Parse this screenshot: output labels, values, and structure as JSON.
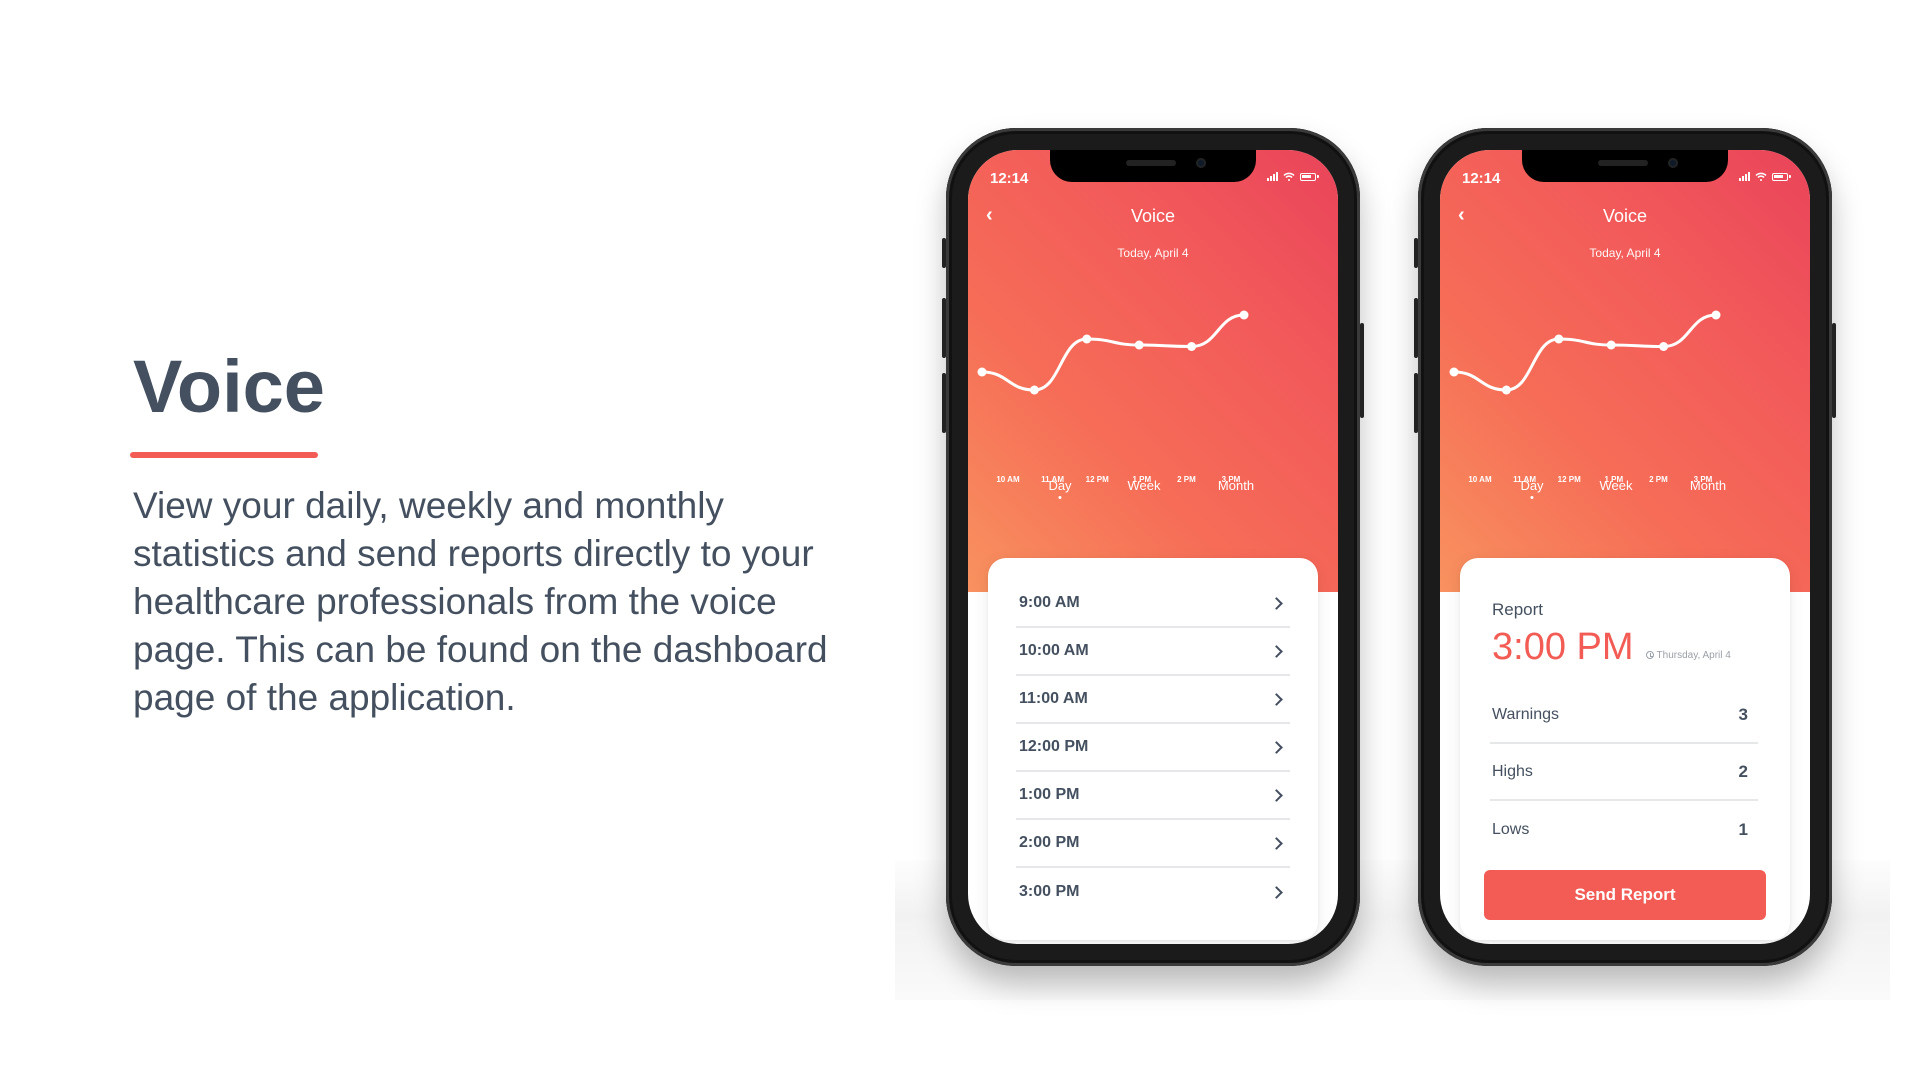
{
  "intro": {
    "heading": "Voice",
    "description": "View your daily, weekly and monthly statistics and send reports directly to your healthcare professionals from the voice page. This can be found on the dashboard page of the application."
  },
  "colors": {
    "accent": "#f25c54",
    "text": "#44505f",
    "gradient_start": "#f8925f",
    "gradient_end": "#e9445a"
  },
  "phones": [
    {
      "status_time": "12:14",
      "status_icons": [
        "signal-icon",
        "wifi-icon",
        "battery-icon"
      ],
      "title": "Voice",
      "subtitle": "Today, April 4",
      "tabs": [
        {
          "label": "Day",
          "active": true
        },
        {
          "label": "Week",
          "active": false
        },
        {
          "label": "Month",
          "active": false
        }
      ],
      "list_items": [
        {
          "label": "9:00 AM"
        },
        {
          "label": "10:00 AM"
        },
        {
          "label": "11:00 AM"
        },
        {
          "label": "12:00 PM"
        },
        {
          "label": "1:00 PM"
        },
        {
          "label": "2:00 PM"
        },
        {
          "label": "3:00 PM"
        }
      ]
    },
    {
      "status_time": "12:14",
      "status_icons": [
        "signal-icon",
        "wifi-icon",
        "battery-icon"
      ],
      "title": "Voice",
      "subtitle": "Today, April 4",
      "tabs": [
        {
          "label": "Day",
          "active": true
        },
        {
          "label": "Week",
          "active": false
        },
        {
          "label": "Month",
          "active": false
        }
      ],
      "report": {
        "title": "Report",
        "time": "3:00 PM",
        "date": "Thursday, April 4",
        "stats": [
          {
            "label": "Warnings",
            "value": "3"
          },
          {
            "label": "Highs",
            "value": "2"
          },
          {
            "label": "Lows",
            "value": "1"
          }
        ],
        "button_label": "Send Report"
      }
    }
  ],
  "chart_data": {
    "type": "line",
    "title": "",
    "xlabel": "",
    "ylabel": "",
    "categories": [
      "10 AM",
      "11 AM",
      "12 PM",
      "1 PM",
      "2 PM",
      "3 PM"
    ],
    "points": [
      {
        "x": 0,
        "y": 40
      },
      {
        "x": 1,
        "y": 28
      },
      {
        "x": 2,
        "y": 62
      },
      {
        "x": 3,
        "y": 58
      },
      {
        "x": 4,
        "y": 57
      },
      {
        "x": 5,
        "y": 78
      }
    ],
    "ylim": [
      0,
      100
    ],
    "grid": false,
    "smooth": true
  }
}
